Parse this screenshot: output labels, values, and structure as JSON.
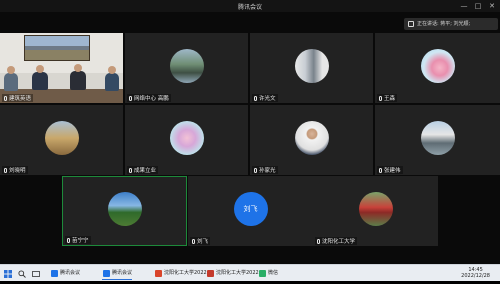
{
  "window": {
    "title": "腾讯会议",
    "controls": [
      "—",
      "□",
      "✕"
    ]
  },
  "banner": {
    "text": "正在讲话: 蒋平; 刘光顺;"
  },
  "tiles": [
    {
      "id": "t1",
      "label": "建筑英语",
      "avatar": "meeting-room-photo"
    },
    {
      "id": "t2",
      "label": "网络中心 高鹏",
      "avatar": "lake-photo"
    },
    {
      "id": "t3",
      "label": "许光文",
      "avatar": "building-photo"
    },
    {
      "id": "t4",
      "label": "王森",
      "avatar": "flower-photo"
    },
    {
      "id": "t5",
      "label": "刘晓明",
      "avatar": "desert-photo"
    },
    {
      "id": "t6",
      "label": "成果立业",
      "avatar": "lotus-photo"
    },
    {
      "id": "t7",
      "label": "孙家光",
      "avatar": "portrait-photo"
    },
    {
      "id": "t8",
      "label": "张建伟",
      "avatar": "pavilion-photo"
    },
    {
      "id": "t9",
      "label": "苗宁宁",
      "avatar": "tree-photo"
    },
    {
      "id": "t10",
      "label": "刘飞",
      "avatar_text": "刘飞"
    },
    {
      "id": "t11",
      "label": "沈阳化工大学",
      "avatar": "train-photo"
    }
  ],
  "taskbar": {
    "items": [
      {
        "label": "腾讯会议",
        "color": "#1e73e8"
      },
      {
        "label": "腾讯会议",
        "color": "#1e73e8"
      },
      {
        "label": "沈阳化工大学2022...",
        "color": "#d9452b"
      },
      {
        "label": "沈阳化工大学2022...",
        "color": "#c43a2c"
      },
      {
        "label": "微信",
        "color": "#2aae67"
      }
    ],
    "time": "14:45",
    "date": "2022/12/28"
  }
}
